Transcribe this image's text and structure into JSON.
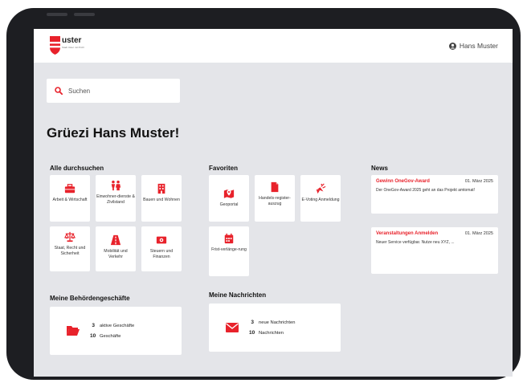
{
  "header": {
    "logo_name": "uster",
    "logo_tagline": "Stadt Uster mit Profil",
    "user_name": "Hans Muster"
  },
  "search": {
    "placeholder": "Suchen"
  },
  "greeting": "Grüezi Hans Muster!",
  "services": {
    "title": "Alle durchsuchen",
    "tiles": [
      {
        "label": "Arbeit & Wirtschaft",
        "icon": "briefcase-icon"
      },
      {
        "label": "Einwohner-dienste & Zivilstand",
        "icon": "people-icon"
      },
      {
        "label": "Bauen und Wohnen",
        "icon": "building-icon"
      },
      {
        "label": "Staat, Recht und Sicherheit",
        "icon": "scales-icon"
      },
      {
        "label": "Mobilität und Verkehr",
        "icon": "road-icon"
      },
      {
        "label": "Steuern und Finanzen",
        "icon": "money-icon"
      }
    ]
  },
  "favorites": {
    "title": "Favoriten",
    "tiles": [
      {
        "label": "Geoportal",
        "icon": "map-pin-icon"
      },
      {
        "label": "Handels-register-auszug",
        "icon": "document-icon"
      },
      {
        "label": "E-Voting Anmeldung",
        "icon": "ballot-icon"
      },
      {
        "label": "Frist-verlänge-rung",
        "icon": "calendar-icon"
      }
    ]
  },
  "news": {
    "title": "News",
    "items": [
      {
        "title": "Gewinn OneGov-Award",
        "date": "01. März 2025",
        "text": "Der OneGov-Award 2025 geht an das Projekt amtomat!"
      },
      {
        "title": "Veranstaltungen Anmelden",
        "date": "01. März 2025",
        "text": "Neuer Service verfügbar. Nutze neu XYZ, ..."
      }
    ]
  },
  "business": {
    "title": "Meine Behördengeschäfte",
    "active_count": "3",
    "active_label": "aktive Geschäfte",
    "total_count": "10",
    "total_label": "Geschäfte"
  },
  "messages": {
    "title": "Meine Nachrichten",
    "new_count": "3",
    "new_label": "neue Nachrichten",
    "total_count": "10",
    "total_label": "Nachrichten"
  },
  "colors": {
    "accent": "#e8222b",
    "background": "#e4e5e9",
    "frame": "#1d1e22"
  }
}
